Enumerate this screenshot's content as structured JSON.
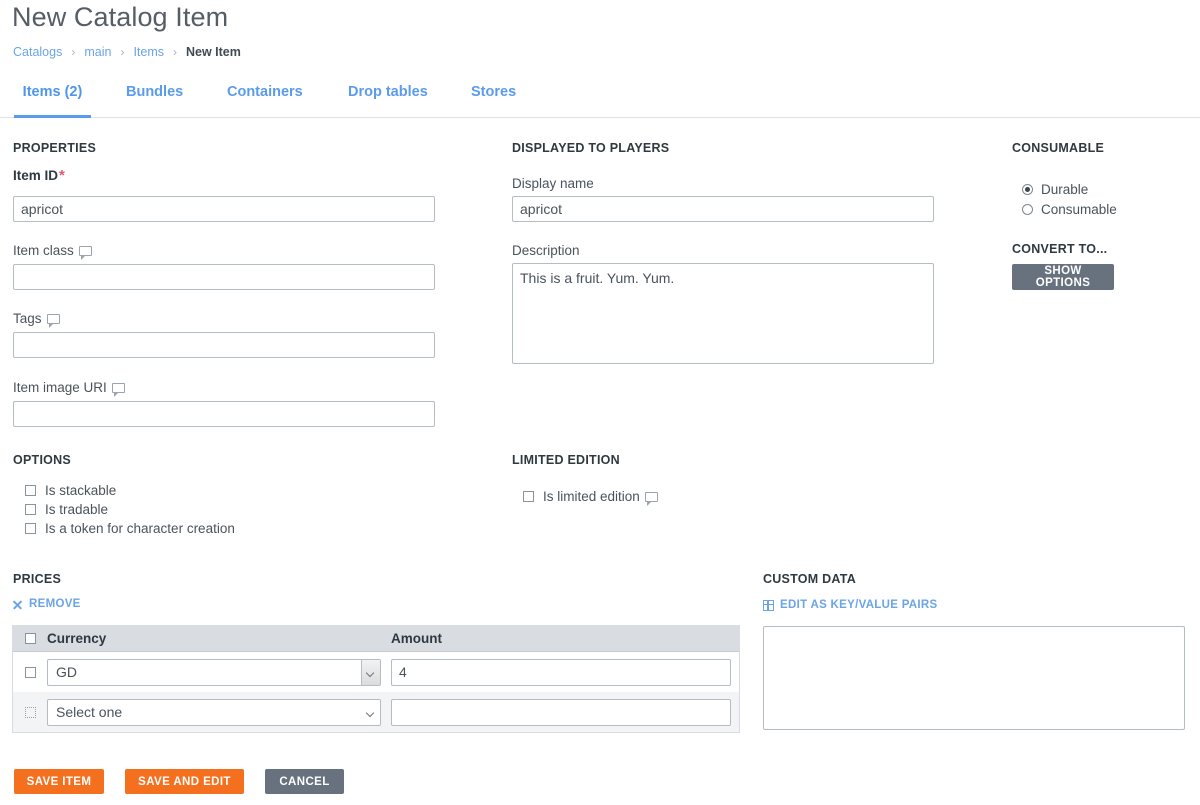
{
  "header": {
    "title": "New Catalog Item",
    "breadcrumb": [
      {
        "label": "Catalogs",
        "current": false
      },
      {
        "label": "main",
        "current": false
      },
      {
        "label": "Items",
        "current": false
      },
      {
        "label": "New Item",
        "current": true
      }
    ],
    "breadcrumb_separator": "›"
  },
  "tabs": [
    {
      "label": "Items (2)",
      "active": true
    },
    {
      "label": "Bundles",
      "active": false
    },
    {
      "label": "Containers",
      "active": false
    },
    {
      "label": "Drop tables",
      "active": false
    },
    {
      "label": "Stores",
      "active": false
    }
  ],
  "properties": {
    "heading": "PROPERTIES",
    "item_id": {
      "label": "Item ID",
      "required_mark": "*",
      "value": "apricot"
    },
    "item_class": {
      "label": "Item class",
      "value": "",
      "has_tooltip": true
    },
    "tags": {
      "label": "Tags",
      "value": "",
      "has_tooltip": true
    },
    "item_image_uri": {
      "label": "Item image URI",
      "value": "",
      "has_tooltip": true
    }
  },
  "displayed": {
    "heading": "DISPLAYED TO PLAYERS",
    "display_name": {
      "label": "Display name",
      "value": "apricot"
    },
    "description": {
      "label": "Description",
      "value": "This is a fruit. Yum. Yum."
    }
  },
  "consumable": {
    "heading": "CONSUMABLE",
    "options": [
      {
        "label": "Durable",
        "selected": true
      },
      {
        "label": "Consumable",
        "selected": false
      }
    ]
  },
  "convert": {
    "heading": "CONVERT TO...",
    "button_label": "Show options"
  },
  "options": {
    "heading": "OPTIONS",
    "items": [
      {
        "label": "Is stackable",
        "checked": false
      },
      {
        "label": "Is tradable",
        "checked": false
      },
      {
        "label": "Is a token for character creation",
        "checked": false
      }
    ]
  },
  "limited_edition": {
    "heading": "LIMITED EDITION",
    "checkbox": {
      "label": "Is limited edition",
      "checked": false,
      "has_tooltip": true
    }
  },
  "prices": {
    "heading": "PRICES",
    "remove_label": "Remove",
    "columns": [
      "Currency",
      "Amount"
    ],
    "rows": [
      {
        "currency": "GD",
        "amount": "4",
        "selected": false,
        "focused": true
      },
      {
        "currency": "Select one",
        "amount": "",
        "selected": false,
        "focused": false
      }
    ]
  },
  "custom_data": {
    "heading": "CUSTOM DATA",
    "edit_link_label": "Edit as key/value pairs",
    "value": ""
  },
  "actions": [
    {
      "label": "Save item",
      "style": "orange"
    },
    {
      "label": "Save and edit",
      "style": "orange"
    },
    {
      "label": "Cancel",
      "style": "grey"
    }
  ],
  "colors": {
    "accent_blue": "#6ba4e7",
    "tab_blue": "#5b9bec",
    "orange": "#f4701f",
    "grey_button": "#68717e",
    "required_red": "#e2556e",
    "table_header": "#d9dde1"
  }
}
